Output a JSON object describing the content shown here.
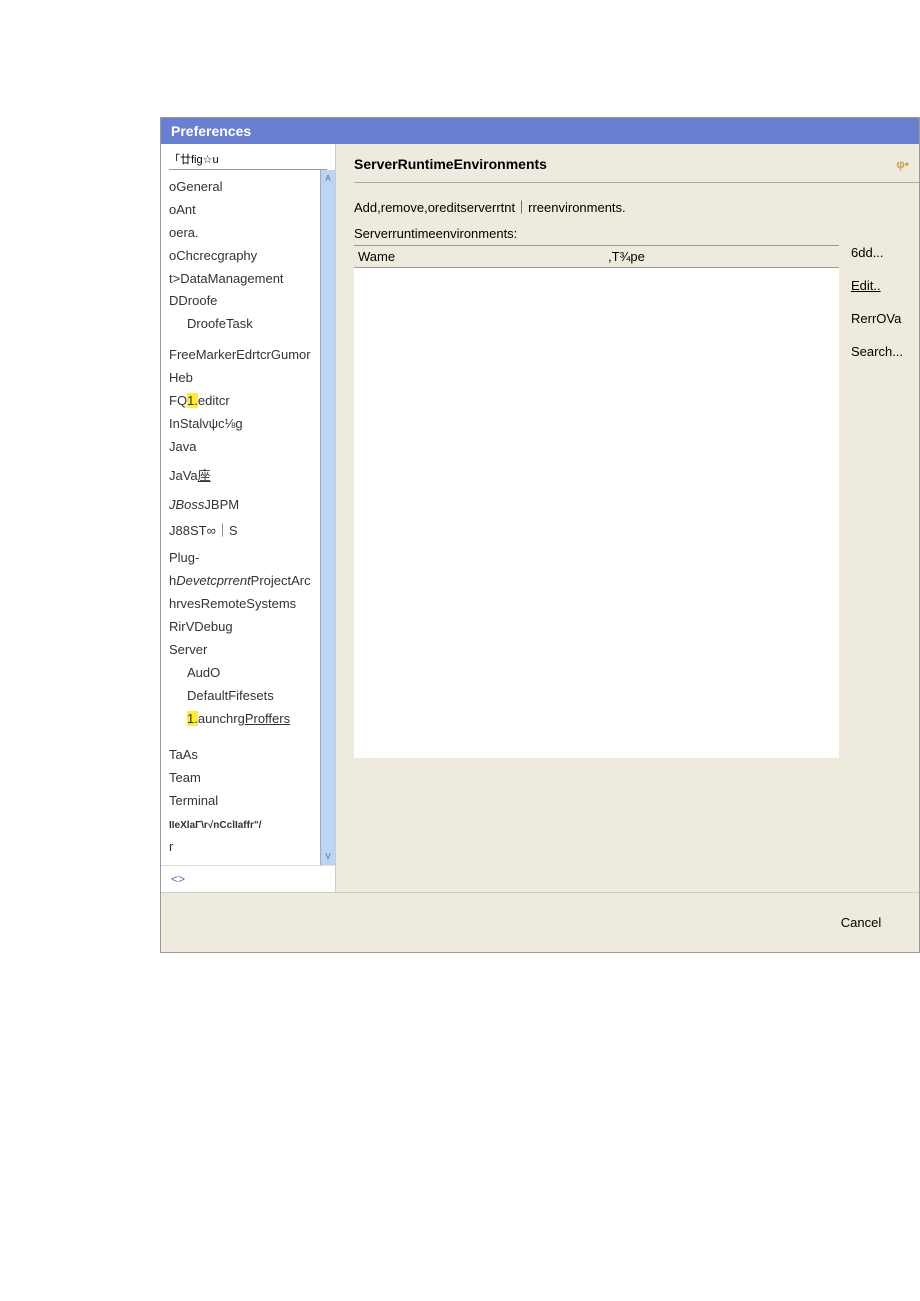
{
  "window": {
    "title": "Preferences"
  },
  "filter": {
    "text": "「廿fig☆u"
  },
  "tree": {
    "items": [
      {
        "label": "oGeneral"
      },
      {
        "label": "oAnt"
      },
      {
        "label": "oera."
      },
      {
        "label": "oChcrecgraphy"
      },
      {
        "label": "t>DataManagement"
      },
      {
        "label": "DDroofe"
      },
      {
        "label": "DroofeTask",
        "sub": true
      },
      {
        "label": "FreeMarkerEdrtcrGumor",
        "spaced": true
      },
      {
        "label": "Heb"
      },
      {
        "pre": "FQ",
        "hl": "1.",
        "post": "editcr"
      },
      {
        "label": "InStalvψc⅛g"
      },
      {
        "label": "Java"
      },
      {
        "label_pre": "JaVa",
        "u": "座",
        "spaced": true
      },
      {
        "it": "JBoss",
        "post": "JBPM",
        "spaced": true
      },
      {
        "label": "J88ST∞｜S",
        "spaced": true
      },
      {
        "label": "Plug-",
        "spaced": true
      },
      {
        "pre": "h",
        "it": "Devetcprrent",
        "post": "ProjectArc"
      },
      {
        "label": "hrvesRemoteSystems"
      },
      {
        "label": "RirVDebug"
      },
      {
        "label": "Server"
      },
      {
        "label": "AudO",
        "sub": true
      },
      {
        "label": "DefaultFifesets",
        "sub": true
      },
      {
        "hl": "1.",
        "post_pre": "aunchrg",
        "u": "Proffers",
        "sub": true
      },
      {
        "label": "TaAs",
        "spaced2": true
      },
      {
        "label": "Team"
      },
      {
        "label": "Terminal"
      },
      {
        "tiny": "IIeXlaΓ\\r√nCclIaffr\"/"
      },
      {
        "label": "r"
      }
    ]
  },
  "nav": {
    "label": "<>"
  },
  "main": {
    "title": "ServerRuntimeEnvironments",
    "help_icon": "φ•",
    "desc": "Add,remove,oreditserverrtnt｜rreenvironments.",
    "sublabel": "Serverruntimeenvironments:",
    "col_name": "Wame",
    "col_type": ",T¾pe"
  },
  "buttons": {
    "add": "6dd...",
    "edit": "Edit..",
    "remove": "RerrOVa",
    "search": "Search..."
  },
  "footer": {
    "cancel": "Cancel"
  },
  "scroll": {
    "up": "A",
    "down": "V"
  }
}
